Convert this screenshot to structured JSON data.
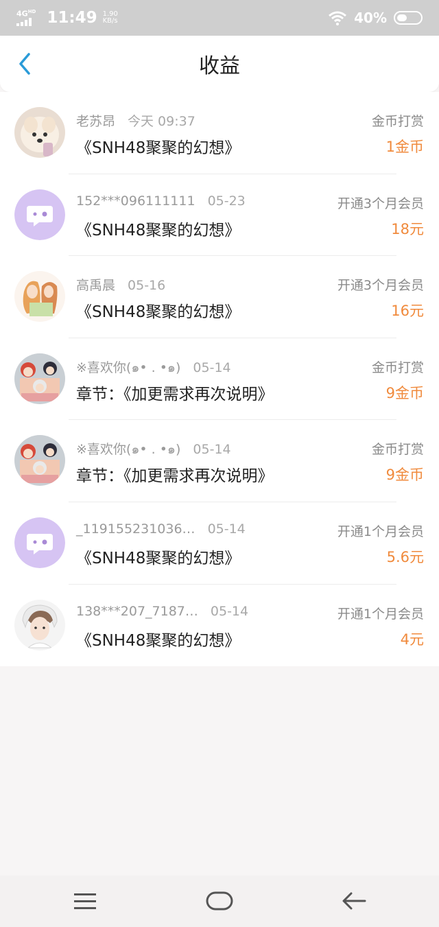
{
  "status_bar": {
    "network": "4G",
    "network_sub": "HD",
    "time": "11:49",
    "speed_value": "1.90",
    "speed_unit": "KB/s",
    "battery": "40%",
    "battery_level": 0.4
  },
  "header": {
    "title": "收益"
  },
  "colors": {
    "accent": "#2a9bd8",
    "amount": "#f08a3c"
  },
  "items": [
    {
      "name": "老苏昂",
      "date": "今天 09:37",
      "title": "《SNH48聚聚的幻想》",
      "type": "金币打赏",
      "amount": "1金币",
      "avatar": "dog"
    },
    {
      "name": "152***096111111",
      "date": "05-23",
      "title": "《SNH48聚聚的幻想》",
      "type": "开通3个月会员",
      "amount": "18元",
      "avatar": "default-chat"
    },
    {
      "name": "高禹晨",
      "date": "05-16",
      "title": "《SNH48聚聚的幻想》",
      "type": "开通3个月会员",
      "amount": "16元",
      "avatar": "anime-couple"
    },
    {
      "name": "※喜欢你(๑• . •๑)",
      "date": "05-14",
      "title": "章节：《加更需求再次说明》",
      "type": "金币打赏",
      "amount": "9金币",
      "avatar": "anime-group"
    },
    {
      "name": "※喜欢你(๑• . •๑)",
      "date": "05-14",
      "title": "章节：《加更需求再次说明》",
      "type": "金币打赏",
      "amount": "9金币",
      "avatar": "anime-group"
    },
    {
      "name": "_119155231036…",
      "date": "05-14",
      "title": "《SNH48聚聚的幻想》",
      "type": "开通1个月会员",
      "amount": "5.6元",
      "avatar": "default-chat"
    },
    {
      "name": "138***207_7187…",
      "date": "05-14",
      "title": "《SNH48聚聚的幻想》",
      "type": "开通1个月会员",
      "amount": "4元",
      "avatar": "anime-boy"
    }
  ]
}
